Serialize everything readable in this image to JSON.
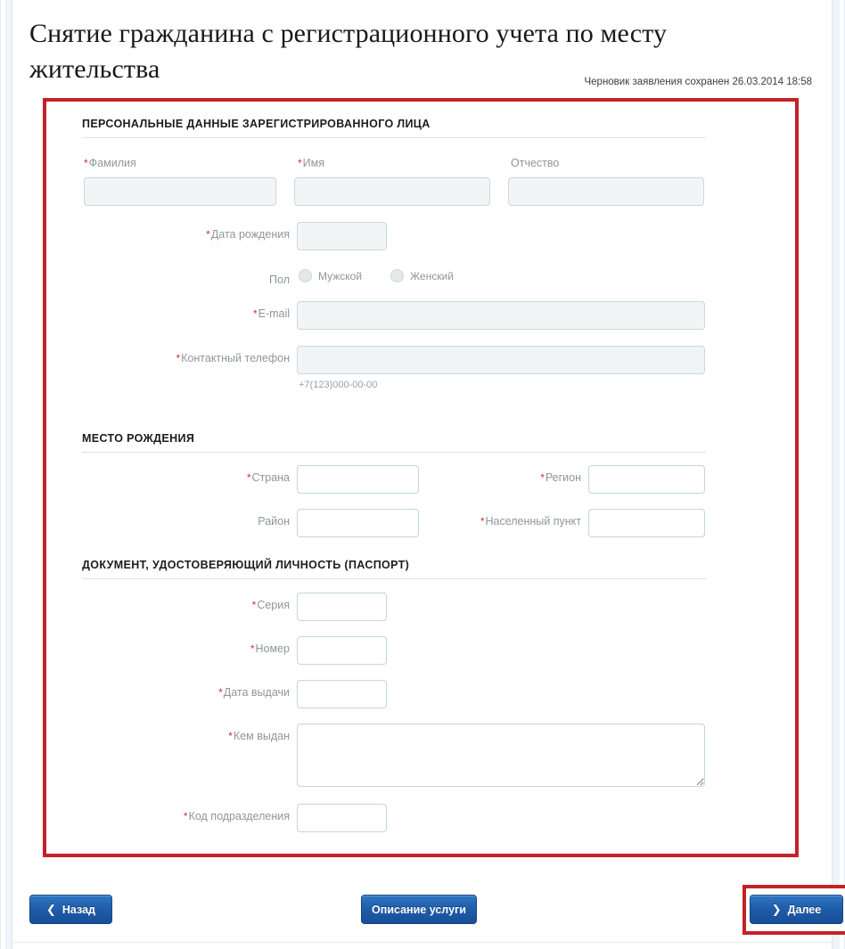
{
  "header": {
    "title": "Снятие гражданина с регистрационного учета по месту жительства",
    "draft_status": "Черновик заявления сохранен 26.03.2014 18:58"
  },
  "sections": [
    {
      "id": "personal",
      "title": "ПЕРСОНАЛЬНЫЕ ДАННЫЕ ЗАРЕГИСТРИРОВАННОГО ЛИЦА",
      "fields": {
        "surname": {
          "label": "Фамилия",
          "required": true,
          "value": ""
        },
        "firstname": {
          "label": "Имя",
          "required": true,
          "value": ""
        },
        "patronymic": {
          "label": "Отчество",
          "required": false,
          "value": ""
        },
        "birthdate": {
          "label": "Дата рождения",
          "required": true,
          "value": ""
        },
        "gender": {
          "label": "Пол",
          "required": false,
          "options": [
            {
              "label": "Мужской",
              "selected": false
            },
            {
              "label": "Женский",
              "selected": false
            }
          ]
        },
        "email": {
          "label": "E-mail",
          "required": true,
          "value": ""
        },
        "phone": {
          "label": "Контактный телефон",
          "required": true,
          "value": "",
          "hint": "+7(123)000-00-00"
        }
      }
    },
    {
      "id": "birthplace",
      "title": "МЕСТО РОЖДЕНИЯ",
      "fields": {
        "country": {
          "label": "Страна",
          "required": true,
          "value": ""
        },
        "region": {
          "label": "Регион",
          "required": true,
          "value": ""
        },
        "district": {
          "label": "Район",
          "required": false,
          "value": ""
        },
        "locality": {
          "label": "Населенный пункт",
          "required": true,
          "value": ""
        }
      }
    },
    {
      "id": "passport",
      "title": "ДОКУМЕНТ, УДОСТОВЕРЯЮЩИЙ ЛИЧНОСТЬ (ПАСПОРТ)",
      "fields": {
        "series": {
          "label": "Серия",
          "required": true,
          "value": ""
        },
        "number": {
          "label": "Номер",
          "required": true,
          "value": ""
        },
        "issue_date": {
          "label": "Дата выдачи",
          "required": true,
          "value": ""
        },
        "issued_by": {
          "label": "Кем выдан",
          "required": true,
          "value": ""
        },
        "division_code": {
          "label": "Код подразделения",
          "required": true,
          "value": ""
        }
      }
    }
  ],
  "footer": {
    "back_label": "Назад",
    "back_icon": "chevron-left-icon",
    "description_label": "Описание услуги",
    "next_label": "Далее",
    "next_icon": "chevron-right-icon"
  },
  "colors": {
    "highlight_red": "#c52127",
    "button_blue": "#1f5ca8",
    "required_red": "#c0392b",
    "label_gray": "#8e9699"
  }
}
